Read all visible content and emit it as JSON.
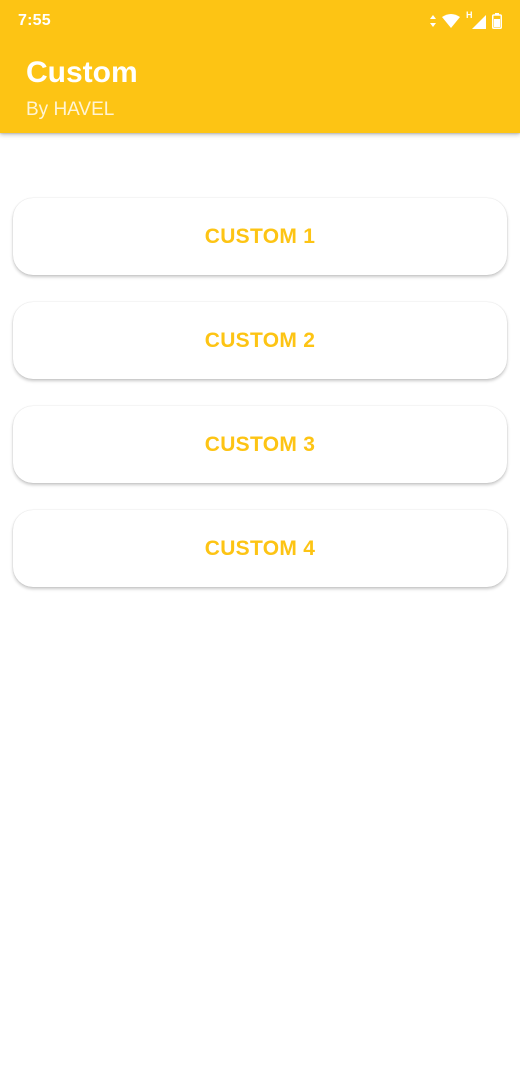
{
  "status_bar": {
    "time": "7:55",
    "network_label": "H",
    "icons": [
      "data-transfer-icon",
      "wifi-icon",
      "signal-icon",
      "battery-icon"
    ]
  },
  "toolbar": {
    "title": "Custom",
    "subtitle": "By HAVEL"
  },
  "buttons": [
    {
      "label": "CUSTOM 1"
    },
    {
      "label": "CUSTOM 2"
    },
    {
      "label": "CUSTOM 3"
    },
    {
      "label": "CUSTOM 4"
    }
  ],
  "colors": {
    "accent": "#FDC414",
    "background": "#FFFFFF",
    "on_accent": "#FFFFFF"
  }
}
